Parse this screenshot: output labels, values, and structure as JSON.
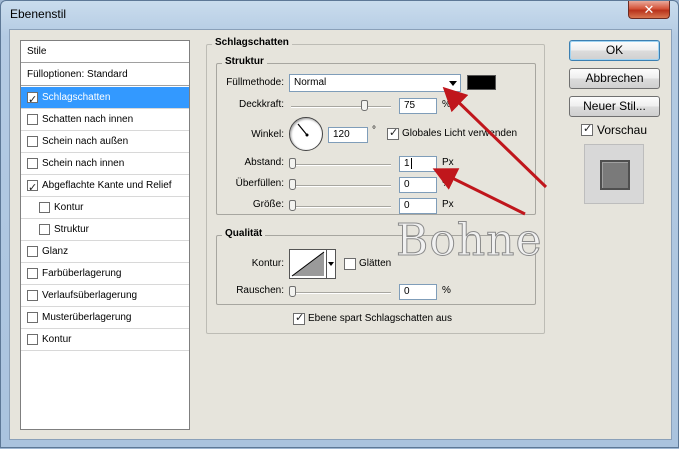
{
  "window": {
    "title": "Ebenenstil",
    "close_glyph": "✕"
  },
  "style_list": {
    "header": "Stile",
    "items": [
      {
        "label": "Fülloptionen: Standard",
        "checkbox": false,
        "checked": false,
        "indent": 0,
        "selected": false
      },
      {
        "label": "Schlagschatten",
        "checkbox": true,
        "checked": true,
        "indent": 0,
        "selected": true
      },
      {
        "label": "Schatten nach innen",
        "checkbox": true,
        "checked": false,
        "indent": 0,
        "selected": false
      },
      {
        "label": "Schein nach außen",
        "checkbox": true,
        "checked": false,
        "indent": 0,
        "selected": false
      },
      {
        "label": "Schein nach innen",
        "checkbox": true,
        "checked": false,
        "indent": 0,
        "selected": false
      },
      {
        "label": "Abgeflachte Kante und Relief",
        "checkbox": true,
        "checked": true,
        "indent": 0,
        "selected": false
      },
      {
        "label": "Kontur",
        "checkbox": true,
        "checked": false,
        "indent": 1,
        "selected": false
      },
      {
        "label": "Struktur",
        "checkbox": true,
        "checked": false,
        "indent": 1,
        "selected": false
      },
      {
        "label": "Glanz",
        "checkbox": true,
        "checked": false,
        "indent": 0,
        "selected": false
      },
      {
        "label": "Farbüberlagerung",
        "checkbox": true,
        "checked": false,
        "indent": 0,
        "selected": false
      },
      {
        "label": "Verlaufsüberlagerung",
        "checkbox": true,
        "checked": false,
        "indent": 0,
        "selected": false
      },
      {
        "label": "Musterüberlagerung",
        "checkbox": true,
        "checked": false,
        "indent": 0,
        "selected": false
      },
      {
        "label": "Kontur",
        "checkbox": true,
        "checked": false,
        "indent": 0,
        "selected": false
      }
    ]
  },
  "panel": {
    "title": "Schlagschatten",
    "struktur": {
      "title": "Struktur",
      "fuellmethode_label": "Füllmethode:",
      "fuellmethode_value": "Normal",
      "shadow_color": "#000000",
      "deckkraft_label": "Deckkraft:",
      "deckkraft_value": "75",
      "deckkraft_unit": "%",
      "deckkraft_level": 0.75,
      "winkel_label": "Winkel:",
      "winkel_value": "120",
      "winkel_unit": "°",
      "globales_licht_label": "Globales Licht verwenden",
      "globales_licht_checked": true,
      "abstand_label": "Abstand:",
      "abstand_value": "1",
      "abstand_unit": "Px",
      "ueberfuellen_label": "Überfüllen:",
      "ueberfuellen_value": "0",
      "ueberfuellen_unit": "%",
      "groesse_label": "Größe:",
      "groesse_value": "0",
      "groesse_unit": "Px"
    },
    "qualitaet": {
      "title": "Qualität",
      "kontur_label": "Kontur:",
      "glaetten_label": "Glätten",
      "glaetten_checked": false,
      "rauschen_label": "Rauschen:",
      "rauschen_value": "0",
      "rauschen_unit": "%"
    },
    "ebene_spart_label": "Ebene spart Schlagschatten aus",
    "ebene_spart_checked": true
  },
  "buttons": {
    "ok": "OK",
    "abbrechen": "Abbrechen",
    "neuer_stil": "Neuer Stil...",
    "vorschau_label": "Vorschau",
    "vorschau_checked": true
  },
  "watermark": "Bohne",
  "annotation_color": "#c0161c"
}
